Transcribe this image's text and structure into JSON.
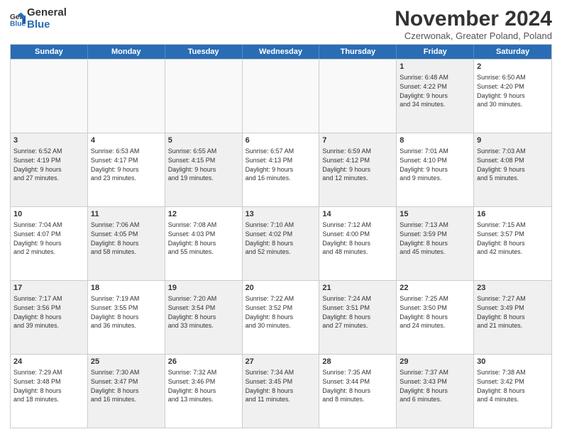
{
  "logo": {
    "general": "General",
    "blue": "Blue"
  },
  "title": "November 2024",
  "subtitle": "Czerwonak, Greater Poland, Poland",
  "header_days": [
    "Sunday",
    "Monday",
    "Tuesday",
    "Wednesday",
    "Thursday",
    "Friday",
    "Saturday"
  ],
  "rows": [
    [
      {
        "day": "",
        "text": "",
        "empty": true
      },
      {
        "day": "",
        "text": "",
        "empty": true
      },
      {
        "day": "",
        "text": "",
        "empty": true
      },
      {
        "day": "",
        "text": "",
        "empty": true
      },
      {
        "day": "",
        "text": "",
        "empty": true
      },
      {
        "day": "1",
        "text": "Sunrise: 6:48 AM\nSunset: 4:22 PM\nDaylight: 9 hours\nand 34 minutes.",
        "empty": false,
        "shaded": true
      },
      {
        "day": "2",
        "text": "Sunrise: 6:50 AM\nSunset: 4:20 PM\nDaylight: 9 hours\nand 30 minutes.",
        "empty": false,
        "shaded": false
      }
    ],
    [
      {
        "day": "3",
        "text": "Sunrise: 6:52 AM\nSunset: 4:19 PM\nDaylight: 9 hours\nand 27 minutes.",
        "empty": false,
        "shaded": true
      },
      {
        "day": "4",
        "text": "Sunrise: 6:53 AM\nSunset: 4:17 PM\nDaylight: 9 hours\nand 23 minutes.",
        "empty": false,
        "shaded": false
      },
      {
        "day": "5",
        "text": "Sunrise: 6:55 AM\nSunset: 4:15 PM\nDaylight: 9 hours\nand 19 minutes.",
        "empty": false,
        "shaded": true
      },
      {
        "day": "6",
        "text": "Sunrise: 6:57 AM\nSunset: 4:13 PM\nDaylight: 9 hours\nand 16 minutes.",
        "empty": false,
        "shaded": false
      },
      {
        "day": "7",
        "text": "Sunrise: 6:59 AM\nSunset: 4:12 PM\nDaylight: 9 hours\nand 12 minutes.",
        "empty": false,
        "shaded": true
      },
      {
        "day": "8",
        "text": "Sunrise: 7:01 AM\nSunset: 4:10 PM\nDaylight: 9 hours\nand 9 minutes.",
        "empty": false,
        "shaded": false
      },
      {
        "day": "9",
        "text": "Sunrise: 7:03 AM\nSunset: 4:08 PM\nDaylight: 9 hours\nand 5 minutes.",
        "empty": false,
        "shaded": true
      }
    ],
    [
      {
        "day": "10",
        "text": "Sunrise: 7:04 AM\nSunset: 4:07 PM\nDaylight: 9 hours\nand 2 minutes.",
        "empty": false,
        "shaded": false
      },
      {
        "day": "11",
        "text": "Sunrise: 7:06 AM\nSunset: 4:05 PM\nDaylight: 8 hours\nand 58 minutes.",
        "empty": false,
        "shaded": true
      },
      {
        "day": "12",
        "text": "Sunrise: 7:08 AM\nSunset: 4:03 PM\nDaylight: 8 hours\nand 55 minutes.",
        "empty": false,
        "shaded": false
      },
      {
        "day": "13",
        "text": "Sunrise: 7:10 AM\nSunset: 4:02 PM\nDaylight: 8 hours\nand 52 minutes.",
        "empty": false,
        "shaded": true
      },
      {
        "day": "14",
        "text": "Sunrise: 7:12 AM\nSunset: 4:00 PM\nDaylight: 8 hours\nand 48 minutes.",
        "empty": false,
        "shaded": false
      },
      {
        "day": "15",
        "text": "Sunrise: 7:13 AM\nSunset: 3:59 PM\nDaylight: 8 hours\nand 45 minutes.",
        "empty": false,
        "shaded": true
      },
      {
        "day": "16",
        "text": "Sunrise: 7:15 AM\nSunset: 3:57 PM\nDaylight: 8 hours\nand 42 minutes.",
        "empty": false,
        "shaded": false
      }
    ],
    [
      {
        "day": "17",
        "text": "Sunrise: 7:17 AM\nSunset: 3:56 PM\nDaylight: 8 hours\nand 39 minutes.",
        "empty": false,
        "shaded": true
      },
      {
        "day": "18",
        "text": "Sunrise: 7:19 AM\nSunset: 3:55 PM\nDaylight: 8 hours\nand 36 minutes.",
        "empty": false,
        "shaded": false
      },
      {
        "day": "19",
        "text": "Sunrise: 7:20 AM\nSunset: 3:54 PM\nDaylight: 8 hours\nand 33 minutes.",
        "empty": false,
        "shaded": true
      },
      {
        "day": "20",
        "text": "Sunrise: 7:22 AM\nSunset: 3:52 PM\nDaylight: 8 hours\nand 30 minutes.",
        "empty": false,
        "shaded": false
      },
      {
        "day": "21",
        "text": "Sunrise: 7:24 AM\nSunset: 3:51 PM\nDaylight: 8 hours\nand 27 minutes.",
        "empty": false,
        "shaded": true
      },
      {
        "day": "22",
        "text": "Sunrise: 7:25 AM\nSunset: 3:50 PM\nDaylight: 8 hours\nand 24 minutes.",
        "empty": false,
        "shaded": false
      },
      {
        "day": "23",
        "text": "Sunrise: 7:27 AM\nSunset: 3:49 PM\nDaylight: 8 hours\nand 21 minutes.",
        "empty": false,
        "shaded": true
      }
    ],
    [
      {
        "day": "24",
        "text": "Sunrise: 7:29 AM\nSunset: 3:48 PM\nDaylight: 8 hours\nand 18 minutes.",
        "empty": false,
        "shaded": false
      },
      {
        "day": "25",
        "text": "Sunrise: 7:30 AM\nSunset: 3:47 PM\nDaylight: 8 hours\nand 16 minutes.",
        "empty": false,
        "shaded": true
      },
      {
        "day": "26",
        "text": "Sunrise: 7:32 AM\nSunset: 3:46 PM\nDaylight: 8 hours\nand 13 minutes.",
        "empty": false,
        "shaded": false
      },
      {
        "day": "27",
        "text": "Sunrise: 7:34 AM\nSunset: 3:45 PM\nDaylight: 8 hours\nand 11 minutes.",
        "empty": false,
        "shaded": true
      },
      {
        "day": "28",
        "text": "Sunrise: 7:35 AM\nSunset: 3:44 PM\nDaylight: 8 hours\nand 8 minutes.",
        "empty": false,
        "shaded": false
      },
      {
        "day": "29",
        "text": "Sunrise: 7:37 AM\nSunset: 3:43 PM\nDaylight: 8 hours\nand 6 minutes.",
        "empty": false,
        "shaded": true
      },
      {
        "day": "30",
        "text": "Sunrise: 7:38 AM\nSunset: 3:42 PM\nDaylight: 8 hours\nand 4 minutes.",
        "empty": false,
        "shaded": false
      }
    ]
  ]
}
